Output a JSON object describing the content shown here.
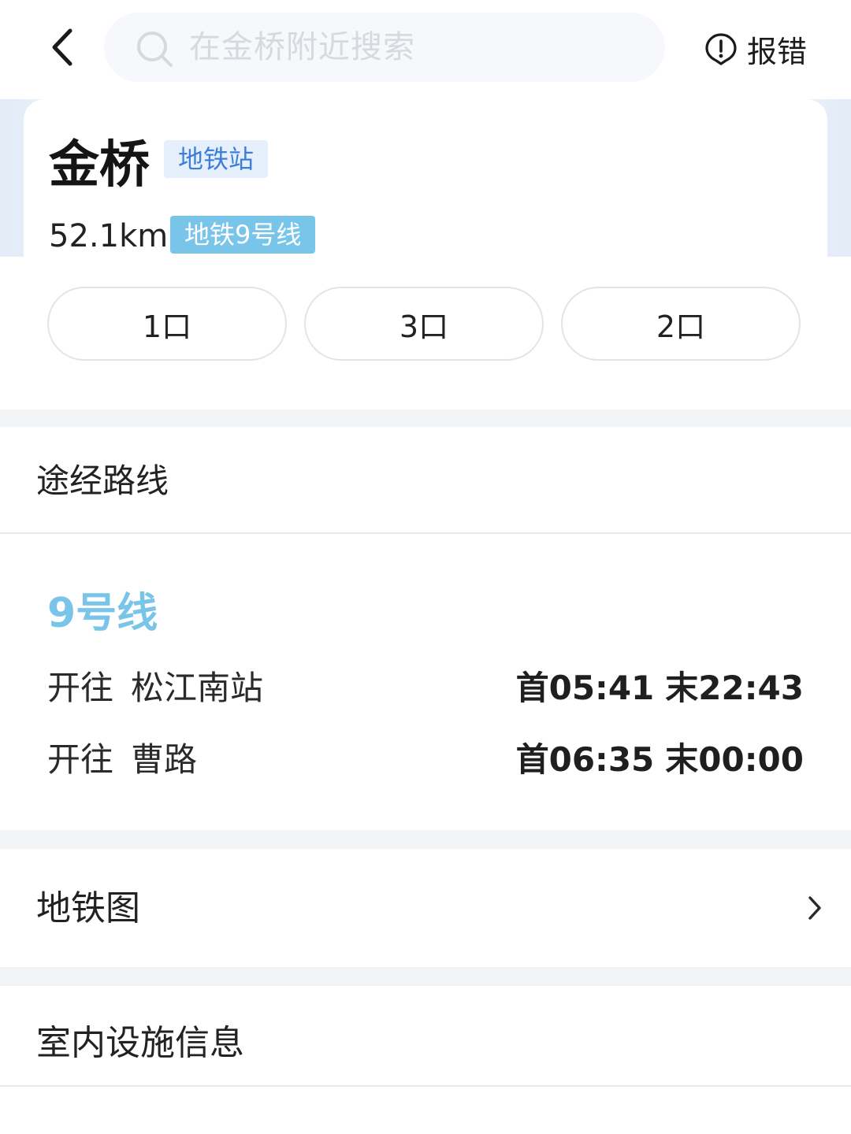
{
  "search": {
    "placeholder": "在金桥附近搜索"
  },
  "header": {
    "report_label": "报错"
  },
  "station": {
    "name": "金桥",
    "type_tag": "地铁站",
    "distance": "52.1km",
    "line_tag": "地铁9号线",
    "exits": [
      "1口",
      "3口",
      "2口"
    ]
  },
  "routes": {
    "section_title": "途经路线",
    "line_name": "9号线",
    "directions": [
      {
        "prefix": "开往",
        "destination": "松江南站",
        "first": "首05:41",
        "last": "末22:43"
      },
      {
        "prefix": "开往",
        "destination": "曹路",
        "first": "首06:35",
        "last": "末00:00"
      }
    ]
  },
  "map": {
    "label": "地铁图"
  },
  "facilities": {
    "label": "室内设施信息"
  },
  "colors": {
    "line_accent": "#79c5ea",
    "tag_blue": "#3d7ed9",
    "tag_bg": "#e6f0fc",
    "section_gap": "#f2f3f5"
  },
  "icons": {
    "back": "chevron-left-icon",
    "search": "search-icon",
    "report": "alert-circle-icon",
    "map_arrow": "chevron-right-icon"
  }
}
